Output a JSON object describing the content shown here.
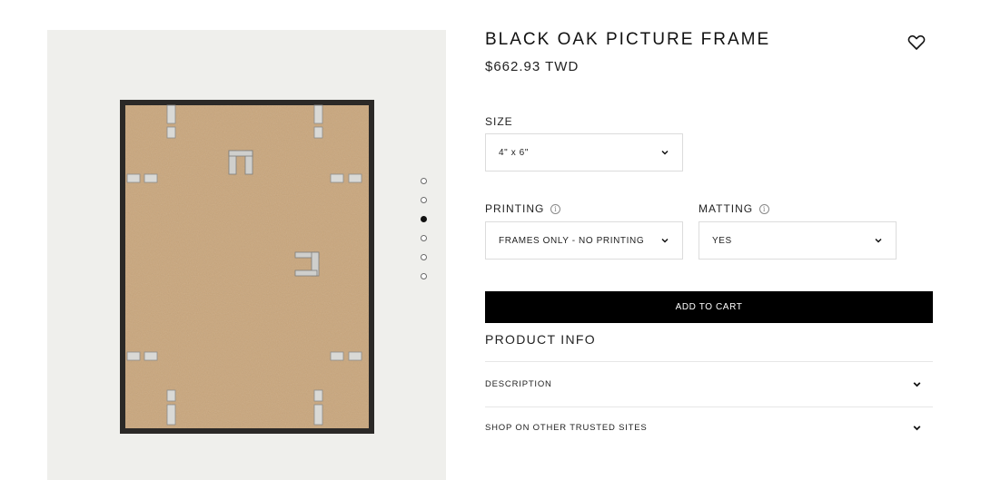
{
  "product": {
    "title": "BLACK OAK PICTURE FRAME",
    "price": "$662.93 TWD"
  },
  "gallery": {
    "image": "black-oak-frame-back-photo",
    "dot_count": 6,
    "active_dot": 3
  },
  "options": {
    "size": {
      "label": "SIZE",
      "value": "4\" x 6\""
    },
    "printing": {
      "label": "PRINTING",
      "value": "FRAMES ONLY - NO PRINTING"
    },
    "matting": {
      "label": "MATTING",
      "value": "YES"
    }
  },
  "actions": {
    "add_to_cart": "ADD TO CART"
  },
  "product_info": {
    "heading": "PRODUCT INFO",
    "sections": [
      "DESCRIPTION",
      "SHOP ON OTHER TRUSTED SITES"
    ]
  },
  "icons": {
    "wishlist": "heart-icon",
    "dropdown": "chevron-down-icon",
    "info": "info-icon"
  },
  "colors": {
    "button_bg": "#000000",
    "gallery_bg": "#efefec",
    "frame": "#2b2927",
    "backing": "#c9a67c"
  }
}
